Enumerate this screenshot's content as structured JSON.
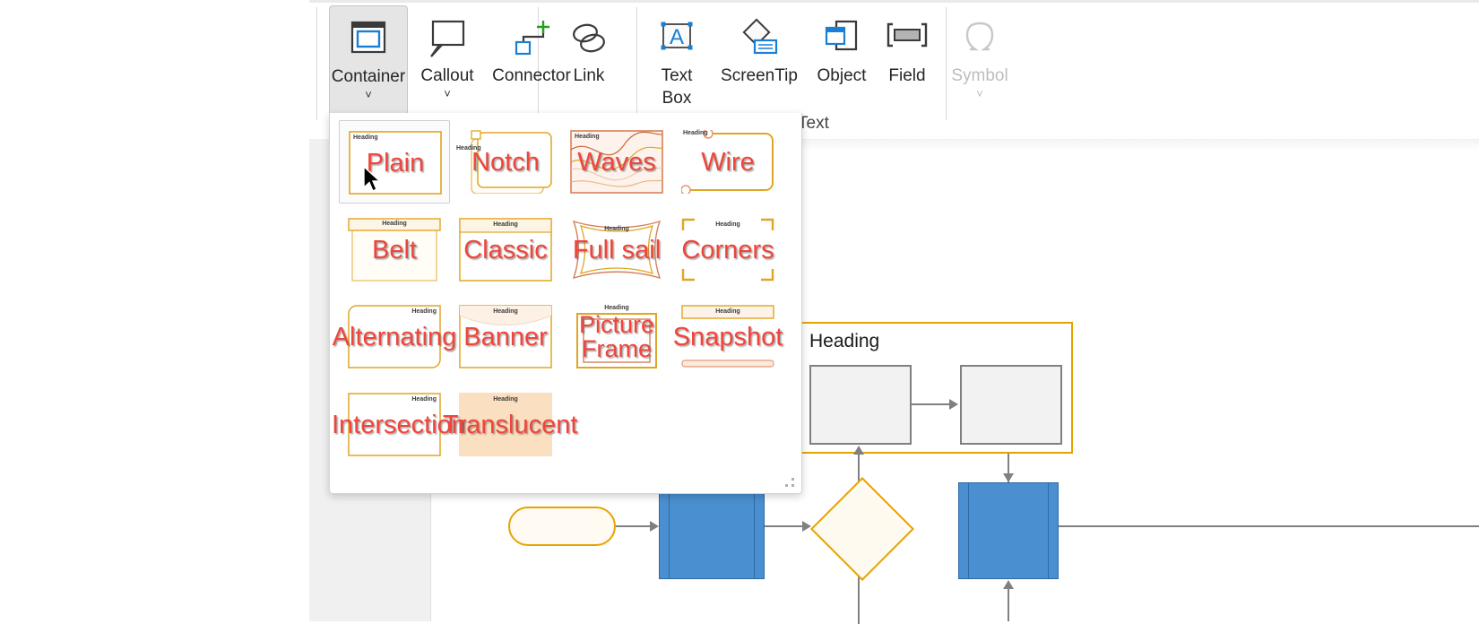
{
  "app": {
    "ribbon": {
      "groups": [
        {
          "label": ""
        },
        {
          "label": "Text"
        }
      ],
      "buttons": [
        {
          "name": "container",
          "label": "Container",
          "has_dropdown": true,
          "active": true,
          "disabled": false,
          "icon": "container-icon"
        },
        {
          "name": "callout",
          "label": "Callout",
          "has_dropdown": true,
          "active": false,
          "disabled": false,
          "icon": "callout-icon"
        },
        {
          "name": "connector",
          "label": "Connector",
          "has_dropdown": false,
          "active": false,
          "disabled": false,
          "icon": "connector-icon"
        },
        {
          "name": "link",
          "label": "Link",
          "has_dropdown": false,
          "active": false,
          "disabled": false,
          "icon": "link-icon"
        },
        {
          "name": "text-box",
          "label": "Text\nBox",
          "has_dropdown": true,
          "active": false,
          "disabled": false,
          "icon": "text-box-icon"
        },
        {
          "name": "screentip",
          "label": "ScreenTip",
          "has_dropdown": false,
          "active": false,
          "disabled": false,
          "icon": "screentip-icon"
        },
        {
          "name": "object",
          "label": "Object",
          "has_dropdown": false,
          "active": false,
          "disabled": false,
          "icon": "object-icon"
        },
        {
          "name": "field",
          "label": "Field",
          "has_dropdown": false,
          "active": false,
          "disabled": false,
          "icon": "field-icon"
        },
        {
          "name": "symbol",
          "label": "Symbol",
          "has_dropdown": true,
          "active": false,
          "disabled": true,
          "icon": "symbol-icon"
        }
      ],
      "text_group_label": "Text"
    },
    "gallery": {
      "heading_placeholder": "Heading",
      "selected": "Plain",
      "items": [
        {
          "name": "Plain",
          "style": "plain"
        },
        {
          "name": "Notch",
          "style": "notch"
        },
        {
          "name": "Waves",
          "style": "waves"
        },
        {
          "name": "Wire",
          "style": "wire"
        },
        {
          "name": "Belt",
          "style": "belt"
        },
        {
          "name": "Classic",
          "style": "classic"
        },
        {
          "name": "Full sail",
          "style": "fullsail"
        },
        {
          "name": "Corners",
          "style": "corners"
        },
        {
          "name": "Alternating",
          "style": "alternating"
        },
        {
          "name": "Banner",
          "style": "banner"
        },
        {
          "name": "Picture\nFrame",
          "style": "pictureframe"
        },
        {
          "name": "Snapshot",
          "style": "snapshot"
        },
        {
          "name": "Intersection",
          "style": "intersection"
        },
        {
          "name": "Translucent",
          "style": "translucent"
        }
      ]
    },
    "canvas": {
      "container_heading": "Heading",
      "shapes": [
        {
          "name": "heading-container",
          "type": "container"
        },
        {
          "name": "process-box-1",
          "type": "rectangle"
        },
        {
          "name": "process-box-2",
          "type": "rectangle"
        },
        {
          "name": "start-terminator",
          "type": "terminator"
        },
        {
          "name": "predefined-process-1",
          "type": "predefined-process"
        },
        {
          "name": "decision-diamond",
          "type": "decision"
        },
        {
          "name": "predefined-process-2",
          "type": "predefined-process"
        }
      ]
    },
    "colors": {
      "accent_orange": "#e8a200",
      "thumb_text_red": "#f0453a",
      "blue_shape": "#4a8fd0",
      "gray_shape": "#f2f2f2",
      "ribbon_active": "#e5e5e5"
    }
  }
}
